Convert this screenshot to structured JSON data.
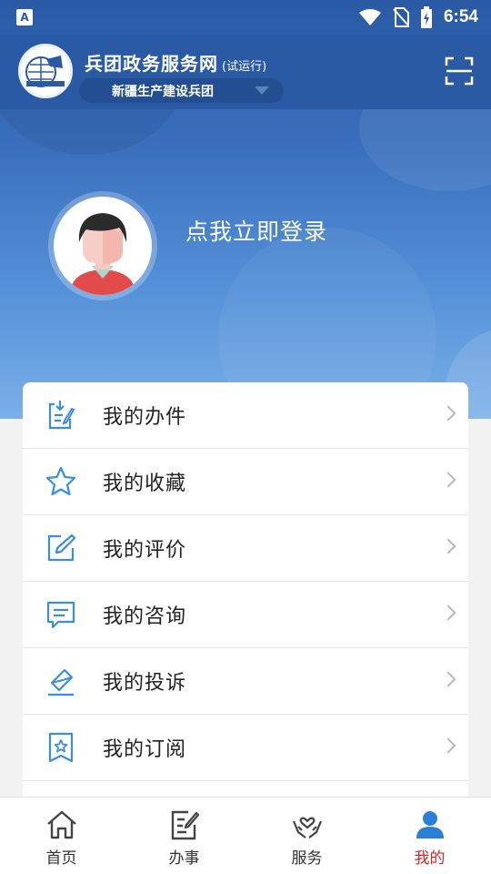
{
  "status_bar": {
    "time": "6:54",
    "notification_icon": "A"
  },
  "header": {
    "title": "兵团政务服务网",
    "subtitle": "(试运行)",
    "region_select": "新疆生产建设兵团"
  },
  "profile": {
    "login_prompt": "点我立即登录"
  },
  "menu": {
    "items": [
      {
        "label": "我的办件",
        "icon": "document-edit-icon"
      },
      {
        "label": "我的收藏",
        "icon": "star-icon"
      },
      {
        "label": "我的评价",
        "icon": "edit-pen-icon"
      },
      {
        "label": "我的咨询",
        "icon": "chat-bubble-icon"
      },
      {
        "label": "我的投诉",
        "icon": "complaint-icon"
      },
      {
        "label": "我的订阅",
        "icon": "bookmark-star-icon"
      }
    ]
  },
  "tabs": [
    {
      "label": "首页",
      "icon": "home-icon",
      "active": false
    },
    {
      "label": "办事",
      "icon": "task-icon",
      "active": false
    },
    {
      "label": "服务",
      "icon": "service-hands-icon",
      "active": false
    },
    {
      "label": "我的",
      "icon": "user-icon",
      "active": true
    }
  ],
  "colors": {
    "primary": "#2a5aa4",
    "icon_blue": "#3a8ee0",
    "active_tab": "#d8262b"
  }
}
